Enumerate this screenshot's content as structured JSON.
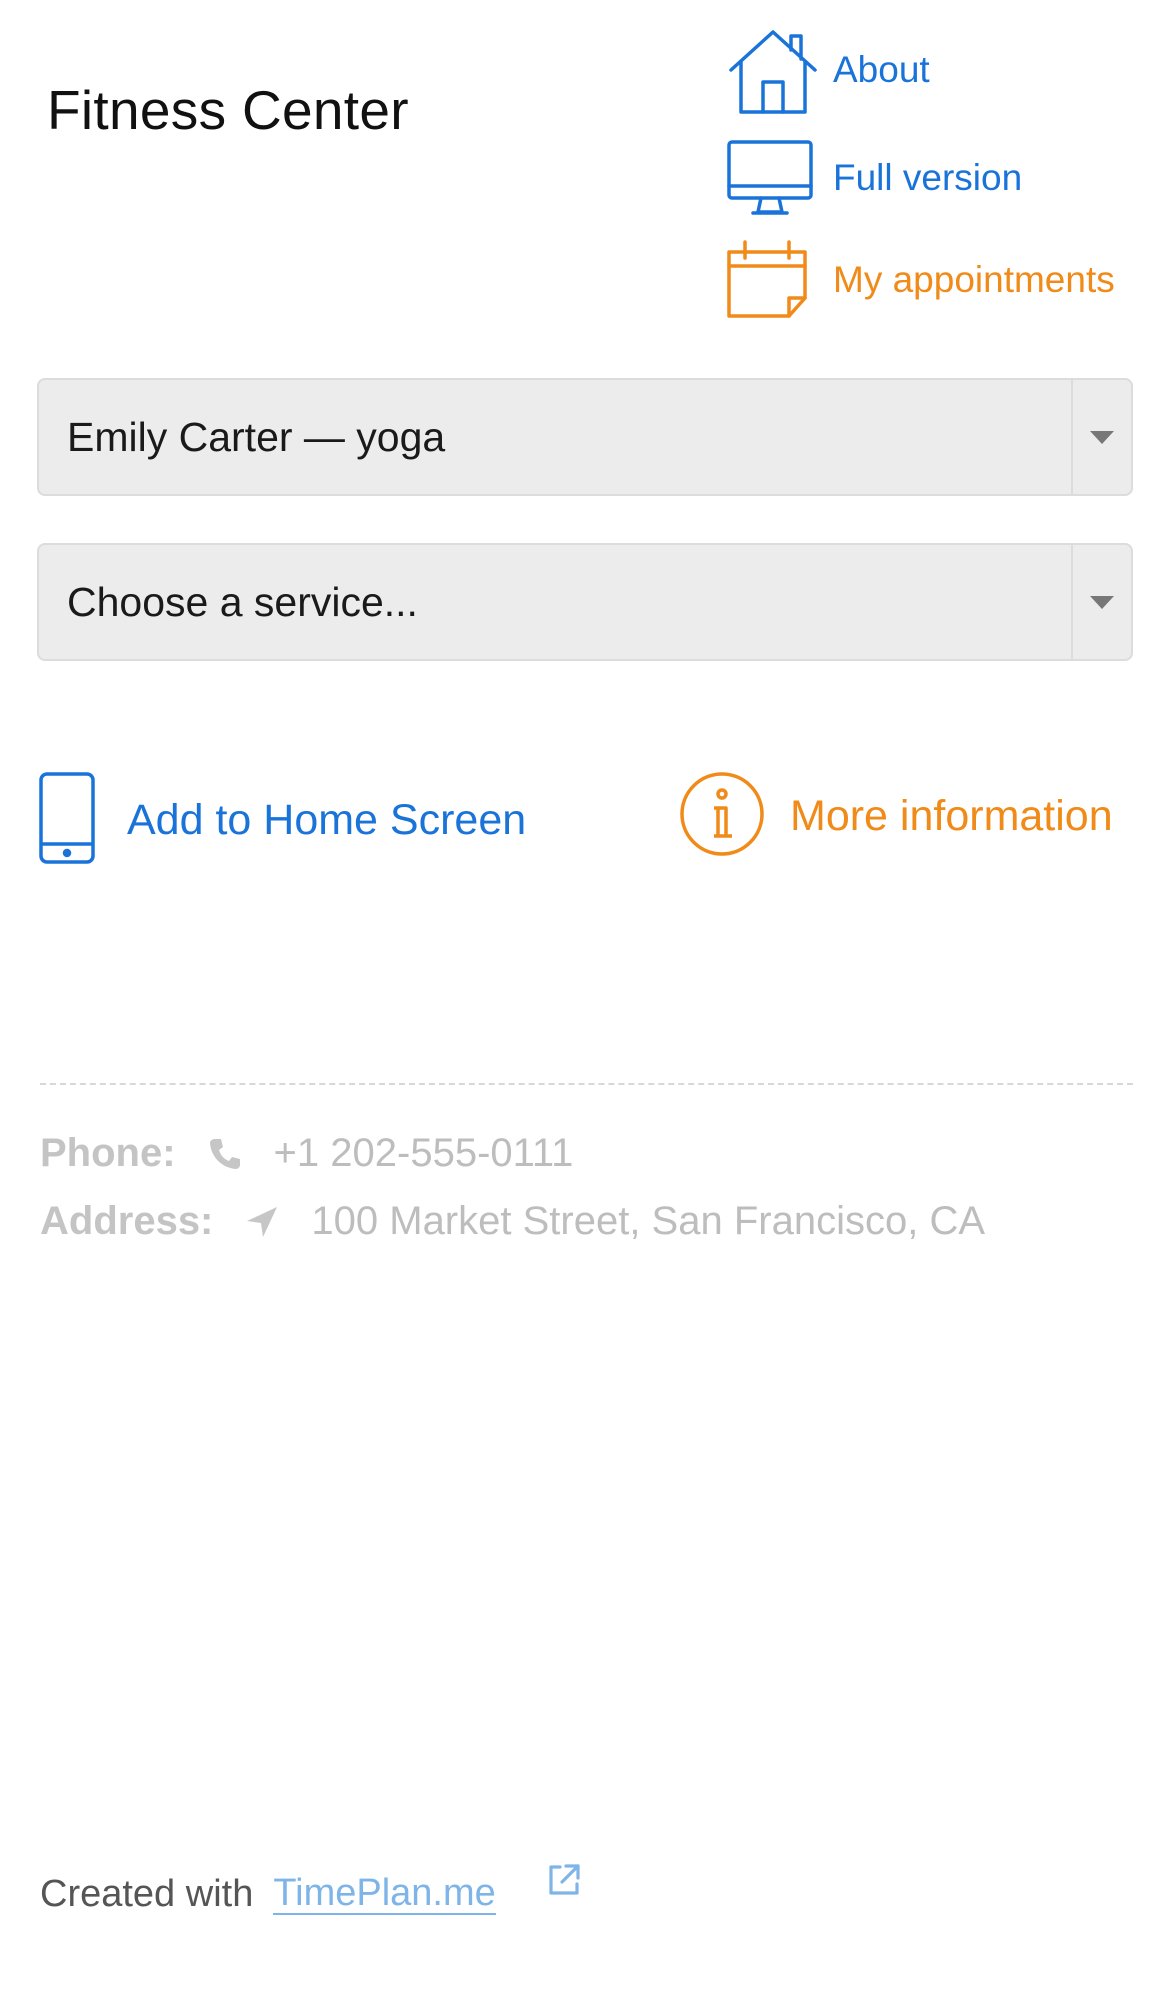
{
  "header": {
    "title": "Fitness Center"
  },
  "nav": {
    "about": "About",
    "full_version": "Full version",
    "my_appointments": "My appointments"
  },
  "selects": {
    "master": "Emily Carter — yoga",
    "service": "Choose a service..."
  },
  "actions": {
    "add_home": "Add to Home Screen",
    "more_info": "More information"
  },
  "contact": {
    "phone_label": "Phone:",
    "phone": "+1 202-555-0111",
    "address_label": "Address:",
    "address": "100 Market Street, San Francisco, CA"
  },
  "footer": {
    "created_with": "Created with",
    "link": "TimePlan.me"
  },
  "colors": {
    "accent_blue": "#1a73d9",
    "accent_orange": "#f08a18"
  },
  "icons": [
    "house-icon",
    "monitor-icon",
    "calendar-icon",
    "phone-device-icon",
    "info-icon",
    "phone-icon",
    "location-arrow-icon",
    "external-link-icon",
    "chevron-down-icon"
  ]
}
